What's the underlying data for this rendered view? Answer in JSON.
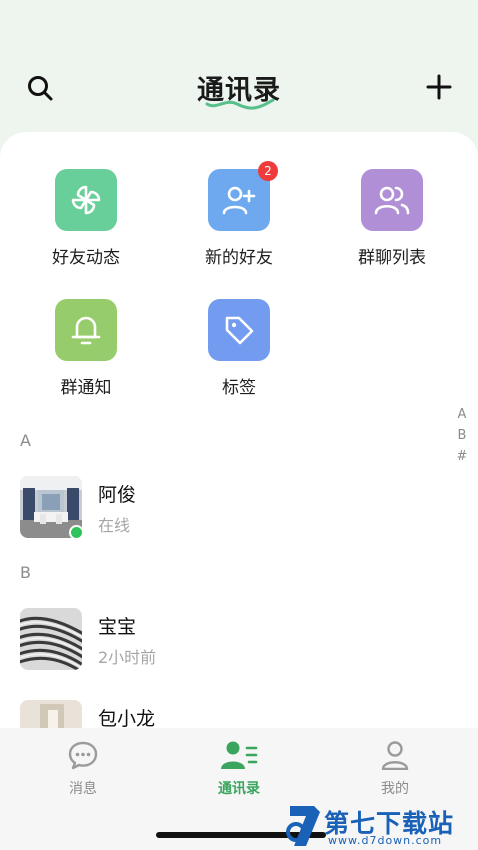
{
  "header": {
    "title": "通讯录"
  },
  "features": [
    {
      "label": "好友动态",
      "icon": "pinwheel-icon",
      "color": "#68cf9a"
    },
    {
      "label": "新的好友",
      "icon": "add-user-icon",
      "color": "#6ea8ee",
      "badge": "2"
    },
    {
      "label": "群聊列表",
      "icon": "group-icon",
      "color": "#b08fd6"
    },
    {
      "label": "群通知",
      "icon": "bell-icon",
      "color": "#97cc6d"
    },
    {
      "label": "标签",
      "icon": "tag-icon",
      "color": "#739bf0"
    }
  ],
  "index_bar": [
    "A",
    "B",
    "#"
  ],
  "sections": [
    {
      "letter": "A",
      "contacts": [
        {
          "name": "阿俊",
          "status": "在线",
          "online": true
        }
      ]
    },
    {
      "letter": "B",
      "contacts": [
        {
          "name": "宝宝",
          "status": "2小时前"
        },
        {
          "name": "包小龙"
        }
      ]
    }
  ],
  "tabs": [
    {
      "label": "消息",
      "icon": "chat-bubble-icon"
    },
    {
      "label": "通讯录",
      "icon": "contacts-icon",
      "active": true
    },
    {
      "label": "我的",
      "icon": "profile-icon"
    }
  ],
  "watermark": {
    "text": "第七下载站",
    "url": "www.d7down.com"
  },
  "colors": {
    "accent": "#3aa55e",
    "online": "#2fc35b",
    "badge": "#ee3b3b"
  }
}
